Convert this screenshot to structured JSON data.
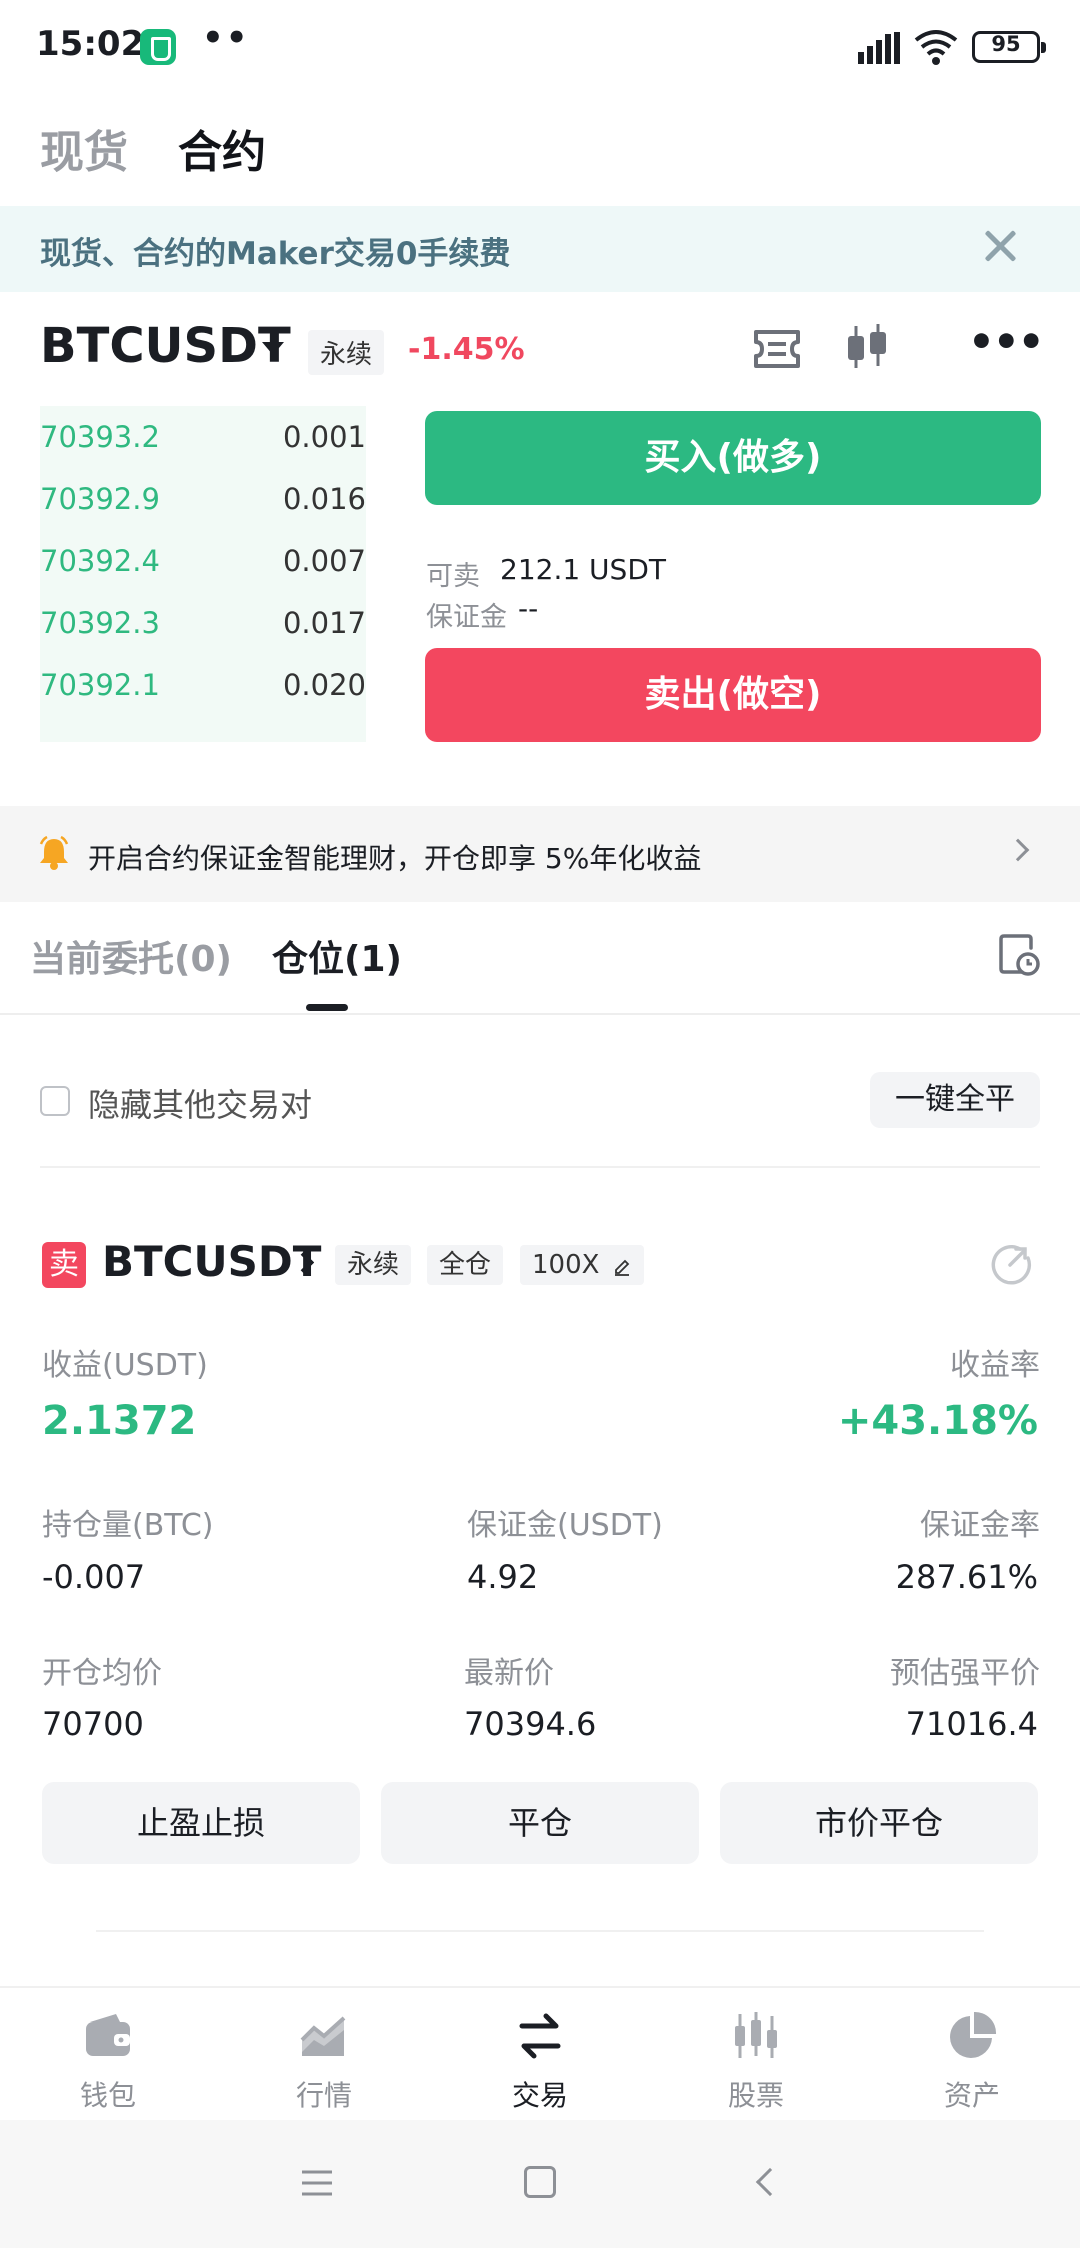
{
  "status_bar": {
    "time": "15:02",
    "dots": "••",
    "battery": "95"
  },
  "top_tabs": {
    "spot": "现货",
    "futures": "合约"
  },
  "promo": {
    "text": "现货、合约的Maker交易0手续费"
  },
  "symbol": {
    "name": "BTCUSDT",
    "tag": "永续",
    "change": "-1.45%"
  },
  "orderbook": [
    {
      "price": "70393.2",
      "qty": "0.001"
    },
    {
      "price": "70392.9",
      "qty": "0.016"
    },
    {
      "price": "70392.4",
      "qty": "0.007"
    },
    {
      "price": "70392.3",
      "qty": "0.017"
    },
    {
      "price": "70392.1",
      "qty": "0.020"
    }
  ],
  "trade": {
    "buy_label": "买入(做多)",
    "sell_label": "卖出(做空)",
    "available_label": "可卖",
    "available_value": "212.1 USDT",
    "margin_label": "保证金",
    "margin_value": "--"
  },
  "notice": {
    "text": "开启合约保证金智能理财，开仓即享 5%年化收益"
  },
  "position_tabs": {
    "open_orders": "当前委托(0)",
    "positions": "仓位(1)"
  },
  "filter": {
    "hide_label": "隐藏其他交易对",
    "close_all": "一键全平"
  },
  "position": {
    "side": "卖",
    "symbol": "BTCUSDT",
    "tag_perpetual": "永续",
    "tag_cross": "全仓",
    "leverage": "100X",
    "pnl_label": "收益(USDT)",
    "pnl_value": "2.1372",
    "roe_label": "收益率",
    "roe_value": "+43.18%",
    "size_label": "持仓量(BTC)",
    "size_value": "-0.007",
    "margin_label": "保证金(USDT)",
    "margin_value": "4.92",
    "margin_ratio_label": "保证金率",
    "margin_ratio_value": "287.61%",
    "entry_label": "开仓均价",
    "entry_value": "70700",
    "mark_label": "最新价",
    "mark_value": "70394.6",
    "liq_label": "预估强平价",
    "liq_value": "71016.4",
    "btn_tpsl": "止盈止损",
    "btn_close": "平仓",
    "btn_market_close": "市价平仓"
  },
  "bottom_nav": {
    "wallet": "钱包",
    "market": "行情",
    "trade": "交易",
    "stocks": "股票",
    "assets": "资产"
  },
  "colors": {
    "green": "#2cb982",
    "red": "#f3475f",
    "text": "#1b1e24",
    "muted": "#8d9096"
  }
}
